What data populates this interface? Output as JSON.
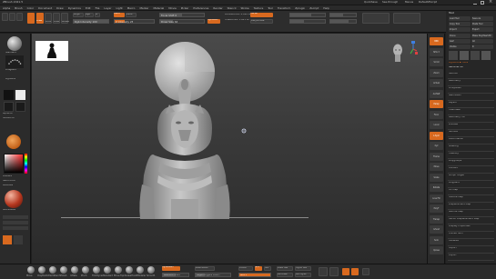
{
  "window": {
    "title": "ZBrush 2021.5",
    "right_buttons": [
      "QuickSave",
      "See-through",
      "Menus",
      "DefaultZScript"
    ]
  },
  "menu": {
    "items": [
      "Alpha",
      "Brush",
      "Color",
      "Document",
      "Draw",
      "Dynamics",
      "Edit",
      "File",
      "Layer",
      "Light",
      "Macro",
      "Marker",
      "Material",
      "Movie",
      "Picker",
      "Preferences",
      "Render",
      "Stencil",
      "Stroke",
      "Texture",
      "Tool",
      "Transform",
      "Zplugin",
      "Zscript",
      "Help"
    ]
  },
  "topshelf": {
    "draw_btn": "Draw",
    "move_btn": "Move",
    "scale_btn": "Scale",
    "rotate_btn": "Rotate",
    "mrgb": "Mrgb",
    "rgb": "Rgb",
    "m_btn": "M",
    "zadd": "Zadd",
    "zsub": "Zsub",
    "focal_shift": "Focal Shift 0",
    "draw_size": "Draw Size 64",
    "dynamic": "Dynamic",
    "active_points": "ActivePoints: 4.094 Mil",
    "total_points": "TotalPoints: 5.821 Mil",
    "z_intensity": "Z Intensity 25",
    "rgb_intensity": "Rgb Intensity 100",
    "curve_btn": "Curve",
    "lazy": "LazyMouse"
  },
  "lefttray": {
    "brush_label": "Standard",
    "lightbox": "LightBox",
    "stroke_label": "DragRect",
    "alpha_label": "Alpha Off",
    "texture_label": "Texture Off",
    "material_label": "SkinShade4",
    "gradient_label": "Gradient",
    "switch_color": "SwitchColor",
    "alternate": "Alternate"
  },
  "rightshelf": {
    "items": [
      "BPR",
      "SPix 3",
      "Scroll",
      "Zoom",
      "Actual",
      "AAHalf",
      "Persp",
      "Floor",
      "Local",
      "L.Sym",
      "Xyz",
      "Frame",
      "Move",
      "Scale",
      "Rotate",
      "Line Fill",
      "PolyF",
      "Transp",
      "Ghost",
      "Solo",
      "Xpose"
    ]
  },
  "righttray": {
    "header": "Tool",
    "buttons": [
      "Load Tool",
      "Save As",
      "Copy Tool",
      "Paste Tool",
      "Import",
      "Export",
      "Clone",
      "Make PolyMesh3D",
      "GoZ",
      "All",
      "Visible",
      "R"
    ],
    "lightbox_tools": "Lightbox ► Tools",
    "current_tool": "Sekhmet 48",
    "sections": [
      "SubTool",
      "Geometry",
      "ArrayMesh",
      "NanoMesh",
      "Layers",
      "FiberMesh",
      "Geometry HD",
      "Preview",
      "Surface",
      "Deformation",
      "Masking",
      "Visibility",
      "Polygroups",
      "Contact",
      "Morph Target",
      "Polypaint",
      "UV Map",
      "Texture Map",
      "Displacement Map",
      "Normal Map",
      "Vector Displacement Map",
      "Display Properties",
      "Unified Skin",
      "Initialize",
      "Import",
      "Export"
    ]
  },
  "bottomshelf": {
    "brushes": [
      "Move",
      "ClayBuildup",
      "DamStandard",
      "hPolish",
      "Inflate",
      "Pinch",
      "TrimDynamic",
      "Standard",
      "Move Topological",
      "SnakeHook",
      "ZModeler",
      "Smooth"
    ],
    "dynamesh": "DynaMesh",
    "resolution": "Resolution 1024",
    "zremesher": "ZRemesher",
    "target": "Target Polygons Count 5",
    "divide": "Divide",
    "smt": "Smt",
    "suv": "Suv",
    "sdiv": "SDiv 5",
    "lower": "Lower Res",
    "higher": "Higher Res",
    "del_lower": "Del Lower",
    "del_higher": "Del Higher"
  },
  "colors": {
    "accent": "#d8691f",
    "canvas_top": "#4a4a4a",
    "canvas_bottom": "#2a2a2a",
    "panel": "#2b2b2b",
    "material": "#b5371f"
  }
}
